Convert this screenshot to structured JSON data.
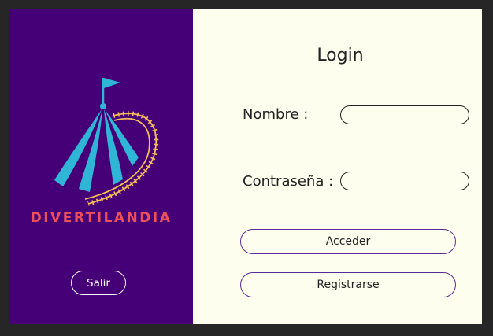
{
  "brand": {
    "name": "DIVERTILANDIA",
    "primary_color": "#460077",
    "accent_color": "#ee4f5d",
    "logo_icon": "circus-tent-rollercoaster-icon"
  },
  "sidebar": {
    "exit_label": "Salir"
  },
  "login": {
    "title": "Login",
    "username_label": "Nombre :",
    "username_value": "",
    "password_label": "Contraseña :",
    "password_value": "",
    "submit_label": "Acceder",
    "register_label": "Registrarse"
  }
}
